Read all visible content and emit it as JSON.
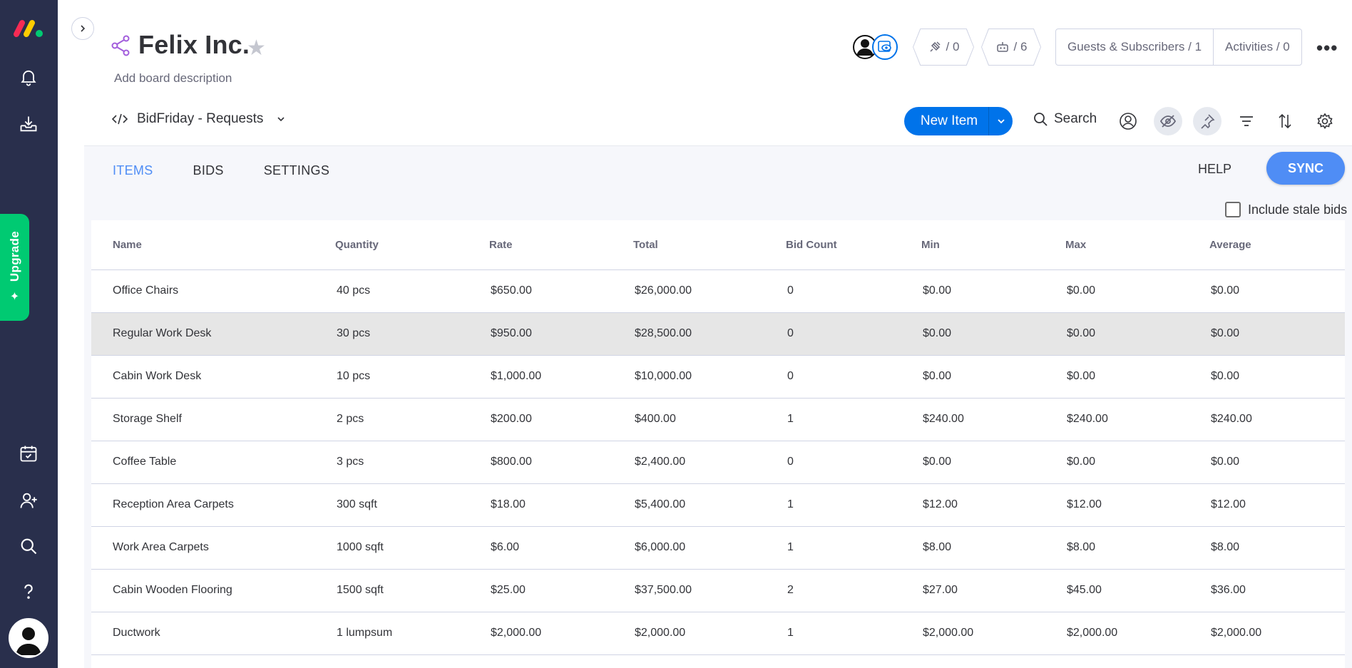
{
  "sidebar": {
    "logo": "monday-logo",
    "icons": [
      "bell-icon",
      "inbox-download-icon",
      "calendar-check-icon",
      "add-user-icon",
      "search-icon",
      "help-icon"
    ],
    "upgrade_label": "Upgrade"
  },
  "header": {
    "title": "Felix Inc.",
    "description": "Add board description",
    "integrations_count": "/ 0",
    "automations_count": "/ 6",
    "guests_label": "Guests & Subscribers / 1",
    "activities_label": "Activities / 0",
    "view_name": "BidFriday - Requests",
    "new_item_label": "New Item",
    "search_label": "Search"
  },
  "app": {
    "tabs": [
      "ITEMS",
      "BIDS",
      "SETTINGS"
    ],
    "active_tab": "ITEMS",
    "help_label": "HELP",
    "sync_label": "SYNC",
    "stale_label": "Include stale bids",
    "stale_checked": false,
    "accent": "#4f8df5"
  },
  "table": {
    "columns": [
      "Name",
      "Quantity",
      "Rate",
      "Total",
      "Bid Count",
      "Min",
      "Max",
      "Average"
    ],
    "rows": [
      [
        "Office Chairs",
        "40 pcs",
        "$650.00",
        "$26,000.00",
        "0",
        "$0.00",
        "$0.00",
        "$0.00"
      ],
      [
        "Regular Work Desk",
        "30 pcs",
        "$950.00",
        "$28,500.00",
        "0",
        "$0.00",
        "$0.00",
        "$0.00"
      ],
      [
        "Cabin Work Desk",
        "10 pcs",
        "$1,000.00",
        "$10,000.00",
        "0",
        "$0.00",
        "$0.00",
        "$0.00"
      ],
      [
        "Storage Shelf",
        "2 pcs",
        "$200.00",
        "$400.00",
        "1",
        "$240.00",
        "$240.00",
        "$240.00"
      ],
      [
        "Coffee Table",
        "3 pcs",
        "$800.00",
        "$2,400.00",
        "0",
        "$0.00",
        "$0.00",
        "$0.00"
      ],
      [
        "Reception Area Carpets",
        "300 sqft",
        "$18.00",
        "$5,400.00",
        "1",
        "$12.00",
        "$12.00",
        "$12.00"
      ],
      [
        "Work Area Carpets",
        "1000 sqft",
        "$6.00",
        "$6,000.00",
        "1",
        "$8.00",
        "$8.00",
        "$8.00"
      ],
      [
        "Cabin Wooden Flooring",
        "1500 sqft",
        "$25.00",
        "$37,500.00",
        "2",
        "$27.00",
        "$45.00",
        "$36.00"
      ],
      [
        "Ductwork",
        "1 lumpsum",
        "$2,000.00",
        "$2,000.00",
        "1",
        "$2,000.00",
        "$2,000.00",
        "$2,000.00"
      ]
    ]
  }
}
